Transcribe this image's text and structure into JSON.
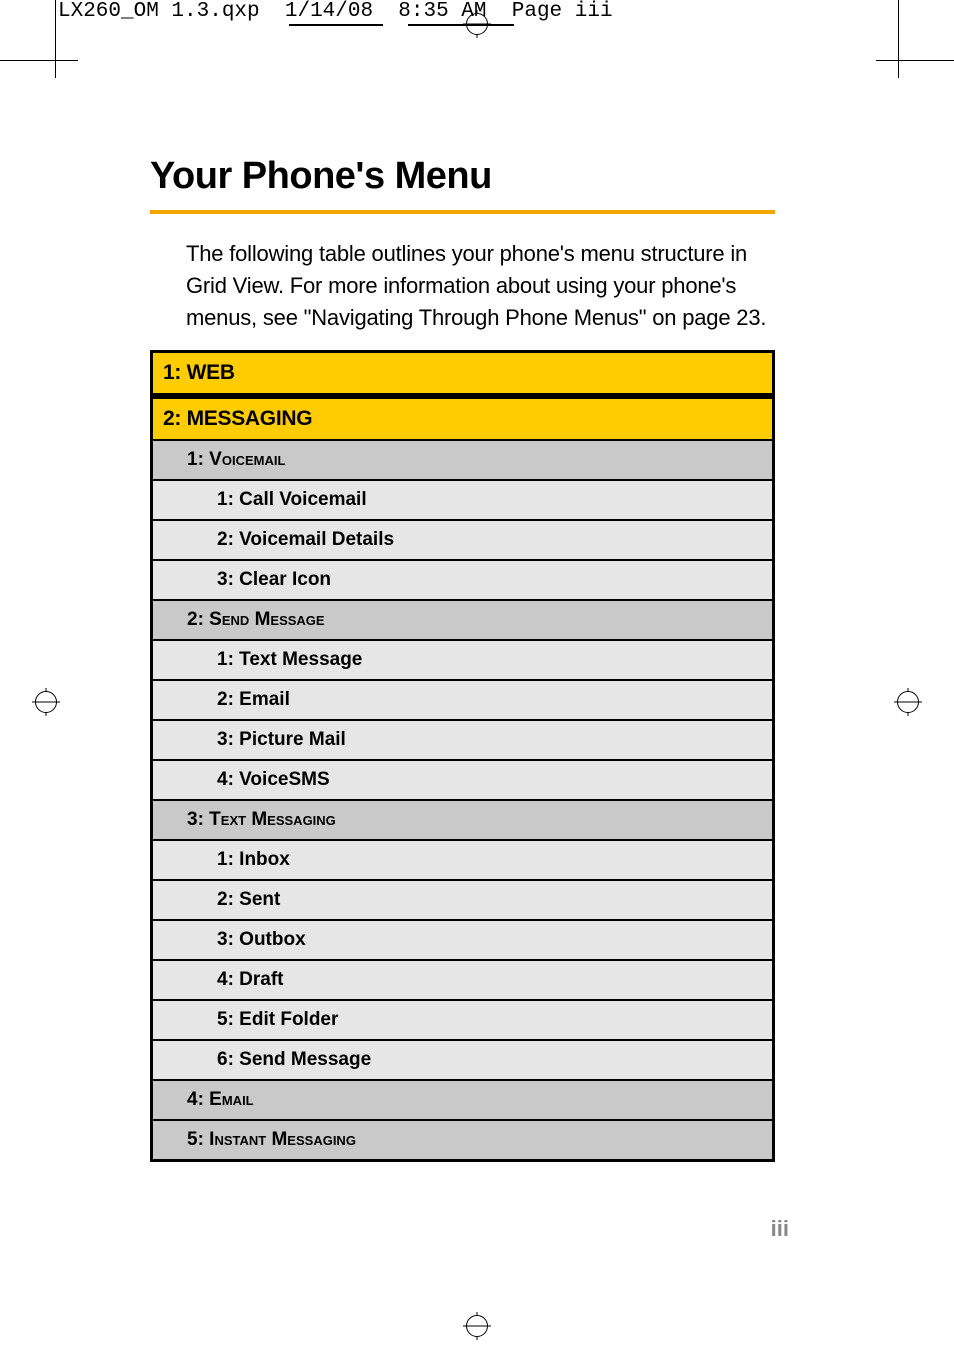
{
  "slug": {
    "filename": "LX260_OM 1.3.qxp",
    "date": "1/14/08",
    "time": "8:35 AM",
    "pagelabel": "Page iii"
  },
  "title": "Your Phone's Menu",
  "intro": "The following table outlines your phone's menu structure in Grid View. For more information about using your phone's menus, see \"Navigating Through Phone Menus\" on page 23.",
  "sections": [
    {
      "label": "1: WEB",
      "groups": []
    },
    {
      "label": "2: MESSAGING",
      "groups": [
        {
          "label": "1: Voicemail",
          "items": [
            "1: Call Voicemail",
            "2: Voicemail Details",
            "3: Clear Icon"
          ]
        },
        {
          "label": "2: Send Message",
          "items": [
            "1: Text Message",
            "2: Email",
            "3: Picture Mail",
            "4: VoiceSMS"
          ]
        },
        {
          "label": "3: Text Messaging",
          "items": [
            "1: Inbox",
            "2: Sent",
            "3: Outbox",
            "4: Draft",
            "5: Edit Folder",
            "6: Send Message"
          ]
        },
        {
          "label": "4: Email",
          "items": []
        },
        {
          "label": "5: Instant Messaging",
          "items": []
        }
      ]
    }
  ],
  "pagenum": "iii"
}
